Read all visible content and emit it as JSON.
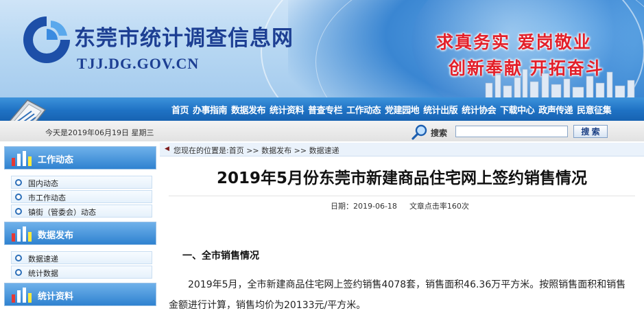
{
  "header": {
    "site_title": "东莞市统计调查信息网",
    "site_url": "TJJ.DG.GOV.CN",
    "slogan_line1": "求真务实 爱岗敬业",
    "slogan_line2": "创新奉献 开拓奋斗"
  },
  "nav": {
    "items": [
      "首页",
      "办事指南",
      "数据发布",
      "统计资料",
      "普查专栏",
      "工作动态",
      "党建园地",
      "统计出版",
      "统计协会",
      "下载中心",
      "政声传递",
      "民意征集"
    ]
  },
  "subbar": {
    "date_text": "今天是2019年06月19日 星期三",
    "search_label": "搜索",
    "search_value": "",
    "search_button": "搜 索"
  },
  "sidebar": {
    "sections": [
      {
        "title": "工作动态",
        "items": [
          "国内动态",
          "市工作动态",
          "镇街（管委会）动态"
        ]
      },
      {
        "title": "数据发布",
        "items": [
          "数据速递",
          "统计数据"
        ]
      },
      {
        "title": "统计资料",
        "items": []
      }
    ]
  },
  "content": {
    "breadcrumb": {
      "prefix": "您现在的位置是:",
      "items": [
        "首页",
        "数据发布",
        "数据速递"
      ],
      "separator": " >> "
    },
    "title": "2019年5月份东莞市新建商品住宅网上签约销售情况",
    "meta_date": "日期：2019-06-18",
    "meta_views": "文章点击率160次",
    "section_heading": "一、全市销售情况",
    "paragraph": "2019年5月，全市新建商品住宅网上签约销售4078套，销售面积46.36万平方米。按照销售面积和销售金额进行计算，销售均价为20133元/平方米。"
  },
  "colors": {
    "brand_blue": "#1d3f93",
    "nav_blue": "#1f72c4",
    "slogan_red": "#e3202a"
  }
}
